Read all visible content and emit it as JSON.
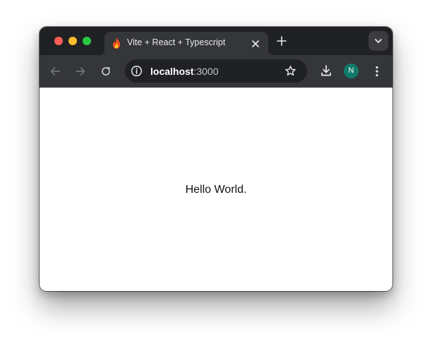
{
  "tab": {
    "title": "Vite + React + Typescript",
    "favicon": "fire-icon"
  },
  "address_bar": {
    "host": "localhost",
    "port": ":3000"
  },
  "profile": {
    "initial": "N",
    "color": "#0f7a6a"
  },
  "page": {
    "message": "Hello World."
  },
  "colors": {
    "titlebar": "#202124",
    "toolbar": "#35363a",
    "omnibox": "#202124",
    "close": "#ff5f57",
    "minimize": "#febc2e",
    "maximize": "#28c840"
  }
}
